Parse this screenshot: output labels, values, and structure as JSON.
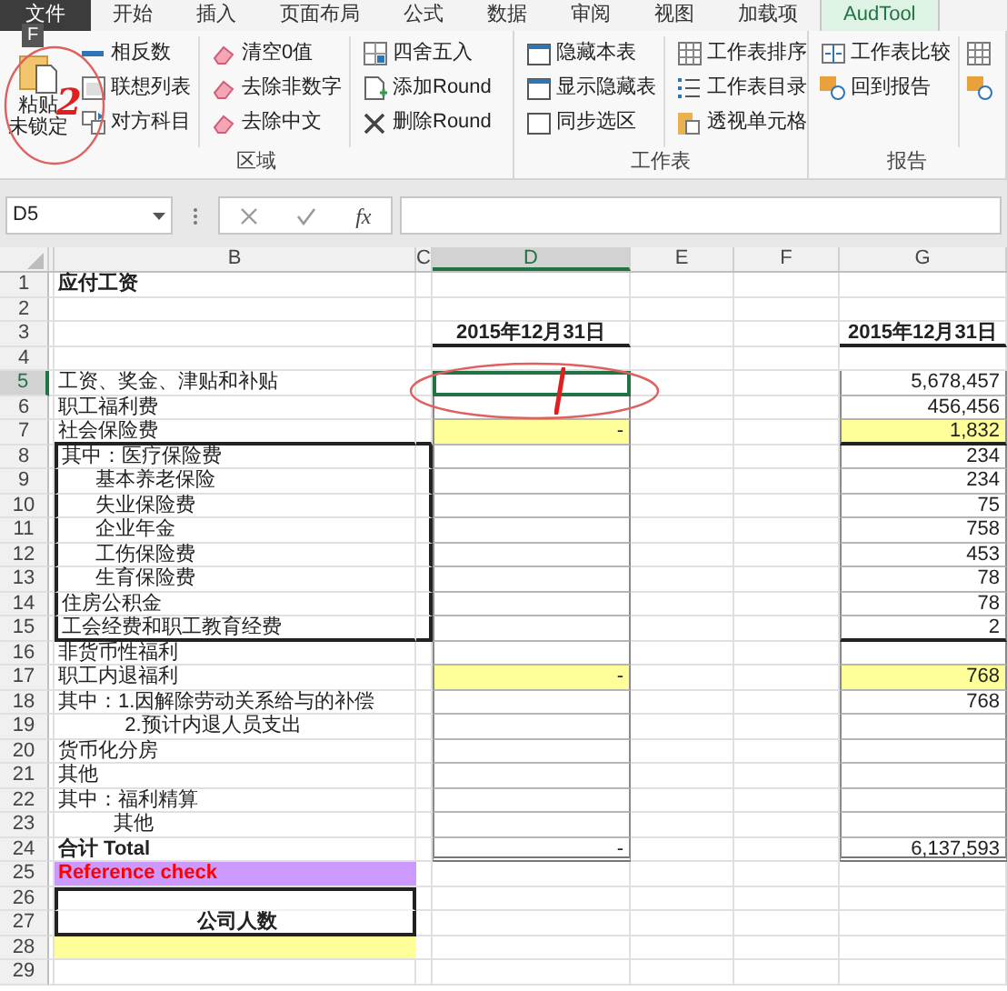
{
  "tabs": [
    {
      "label": "文件",
      "kind": "file",
      "selected": false
    },
    {
      "label": "开始",
      "kind": "tab",
      "selected": false
    },
    {
      "label": "插入",
      "kind": "tab",
      "selected": false
    },
    {
      "label": "页面布局",
      "kind": "tab",
      "selected": false
    },
    {
      "label": "公式",
      "kind": "tab",
      "selected": false
    },
    {
      "label": "数据",
      "kind": "tab",
      "selected": false
    },
    {
      "label": "审阅",
      "kind": "tab",
      "selected": false
    },
    {
      "label": "视图",
      "kind": "tab",
      "selected": false
    },
    {
      "label": "加载项",
      "kind": "tab",
      "selected": false
    },
    {
      "label": "AudTool",
      "kind": "tab",
      "selected": true
    }
  ],
  "keytip": "F",
  "paste_button": {
    "label_lines": [
      "粘贴",
      "未锁定"
    ]
  },
  "ribbon_groups": [
    {
      "label": "区域",
      "columns": [
        [
          "相反数",
          "联想列表",
          "对方科目"
        ],
        [
          "清空0值",
          "去除非数字",
          "去除中文"
        ],
        [
          "四舍五入",
          "添加Round",
          "删除Round"
        ]
      ]
    },
    {
      "label": "工作表",
      "columns": [
        [
          "隐藏本表",
          "显示隐藏表",
          "同步选区"
        ],
        [
          "工作表排序",
          "工作表目录",
          "透视单元格"
        ]
      ]
    },
    {
      "label": "报告",
      "columns": [
        [
          "工作表比较",
          "回到报告"
        ]
      ]
    }
  ],
  "formula_bar": {
    "name_box": "D5",
    "function_button": "fx"
  },
  "columns": [
    {
      "label": "B",
      "selected": false
    },
    {
      "label": "C",
      "selected": false
    },
    {
      "label": "D",
      "selected": true
    },
    {
      "label": "E",
      "selected": false
    },
    {
      "label": "F",
      "selected": false
    },
    {
      "label": "G",
      "selected": false
    }
  ],
  "rows": [
    {
      "n": "1",
      "b": "应付工资",
      "kind": "title",
      "selected": false
    },
    {
      "n": "2",
      "kind": "blank",
      "selected": false
    },
    {
      "n": "3",
      "d": "2015年12月31日",
      "g": "2015年12月31日",
      "kind": "date",
      "selected": false
    },
    {
      "n": "4",
      "kind": "blank",
      "selected": false
    },
    {
      "n": "5",
      "b": "工资、奖金、津贴和补贴",
      "g": "5,678,457",
      "kind": "item",
      "selected": true
    },
    {
      "n": "6",
      "b": "职工福利费",
      "g": "456,456",
      "kind": "item",
      "selected": false
    },
    {
      "n": "7",
      "b": "社会保险费",
      "d": "-",
      "g": "1,832",
      "kind": "subtotal",
      "selected": false
    },
    {
      "n": "8",
      "b": "其中：医疗保险费",
      "g": "234",
      "kind": "grouped_item",
      "selected": false
    },
    {
      "n": "9",
      "b": "      基本养老保险",
      "g": "234",
      "kind": "grouped_item",
      "selected": false
    },
    {
      "n": "10",
      "b": "      失业保险费",
      "g": "75",
      "kind": "grouped_item",
      "selected": false
    },
    {
      "n": "11",
      "b": "      企业年金",
      "g": "758",
      "kind": "grouped_item",
      "selected": false
    },
    {
      "n": "12",
      "b": "      工伤保险费",
      "g": "453",
      "kind": "grouped_item",
      "selected": false
    },
    {
      "n": "13",
      "b": "      生育保险费",
      "g": "78",
      "kind": "grouped_item",
      "selected": false
    },
    {
      "n": "14",
      "b": "住房公积金",
      "g": "78",
      "kind": "grouped_item",
      "selected": false
    },
    {
      "n": "15",
      "b": "工会经费和职工教育经费",
      "g": "2",
      "kind": "grouped_item",
      "selected": false
    },
    {
      "n": "16",
      "b": "非货币性福利",
      "kind": "item",
      "selected": false
    },
    {
      "n": "17",
      "b": "职工内退福利",
      "d": "-",
      "g": "768",
      "kind": "subtotal",
      "selected": false
    },
    {
      "n": "18",
      "b": "其中：1.因解除劳动关系给与的补偿",
      "g": "768",
      "kind": "item",
      "selected": false
    },
    {
      "n": "19",
      "b": "            2.预计内退人员支出",
      "kind": "item",
      "selected": false
    },
    {
      "n": "20",
      "b": "货币化分房",
      "kind": "item",
      "selected": false
    },
    {
      "n": "21",
      "b": "其他",
      "kind": "item",
      "selected": false
    },
    {
      "n": "22",
      "b": "其中：福利精算",
      "kind": "item",
      "selected": false
    },
    {
      "n": "23",
      "b": "          其他",
      "kind": "item",
      "selected": false
    },
    {
      "n": "24",
      "b": "合计 Total",
      "d": "-",
      "g": "6,137,593",
      "kind": "total",
      "selected": false
    },
    {
      "n": "25",
      "b": "Reference check",
      "kind": "reference",
      "selected": false
    },
    {
      "n": "26",
      "kind": "box",
      "selected": false
    },
    {
      "n": "27",
      "b": "公司人数",
      "kind": "box",
      "selected": false
    },
    {
      "n": "28",
      "kind": "input",
      "selected": false
    },
    {
      "n": "29",
      "kind": "blank",
      "selected": false
    }
  ],
  "annotations": {
    "number": "2"
  }
}
